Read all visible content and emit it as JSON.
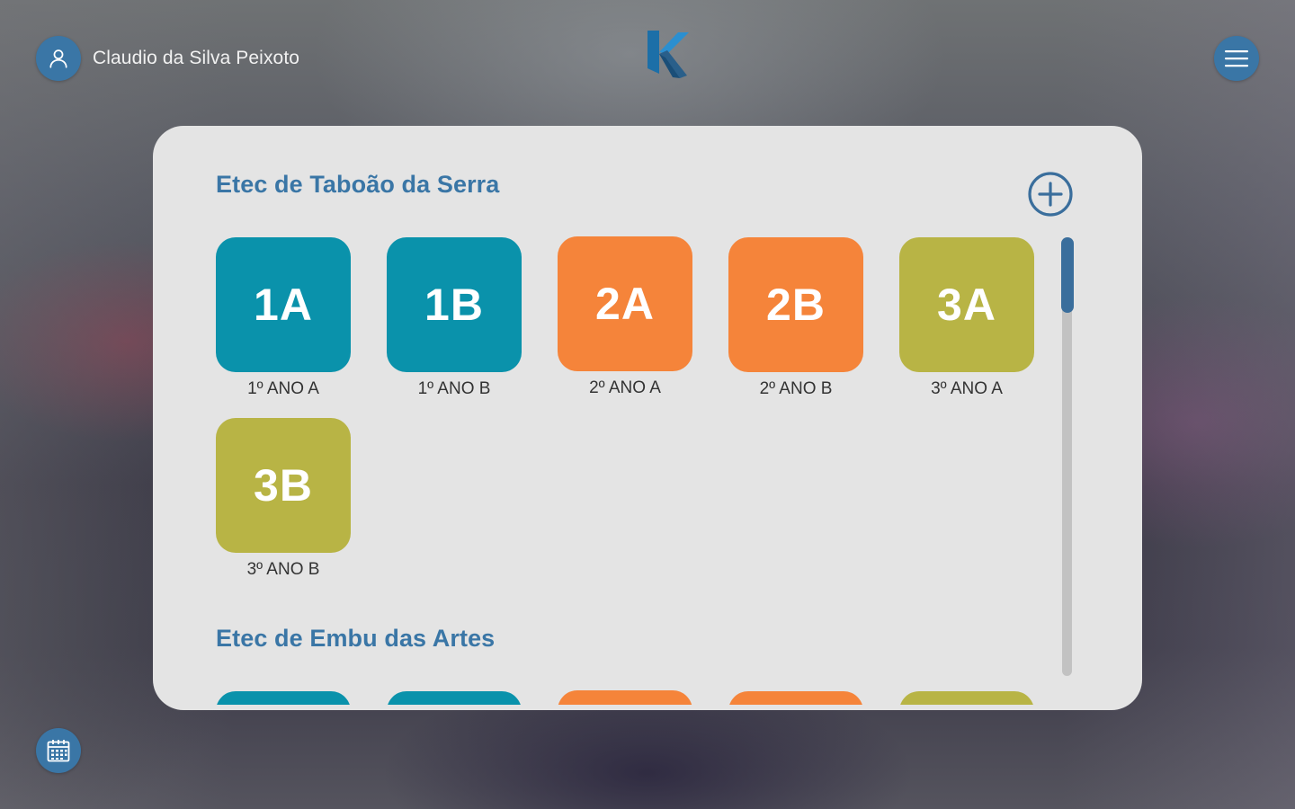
{
  "header": {
    "user_name": "Claudio da Silva Peixoto",
    "user_icon": "user-icon",
    "menu_icon": "hamburger-menu-icon",
    "logo_icon": "k-logo-icon"
  },
  "footer": {
    "calendar_icon": "calendar-icon"
  },
  "panel": {
    "add_icon": "plus-circle-icon",
    "schools": [
      {
        "name": "Etec de Taboão da Serra",
        "classes": [
          {
            "code": "1A",
            "label": "1º ANO A",
            "color": "#0a92ab"
          },
          {
            "code": "1B",
            "label": "1º ANO B",
            "color": "#0a92ab"
          },
          {
            "code": "2A",
            "label": "2º ANO A",
            "color": "#f5843a"
          },
          {
            "code": "2B",
            "label": "2º ANO B",
            "color": "#f5843a"
          },
          {
            "code": "3A",
            "label": "3º ANO A",
            "color": "#b8b445"
          },
          {
            "code": "3B",
            "label": "3º ANO B",
            "color": "#b8b445"
          }
        ]
      },
      {
        "name": "Etec de Embu das Artes",
        "classes": [
          {
            "color": "#0a92ab"
          },
          {
            "color": "#0a92ab"
          },
          {
            "color": "#f5843a"
          },
          {
            "color": "#f5843a"
          },
          {
            "color": "#b8b445"
          }
        ]
      }
    ]
  },
  "colors": {
    "accent": "#3a76a6",
    "panel_bg": "#e4e4e4",
    "teal": "#0a92ab",
    "orange": "#f5843a",
    "olive": "#b8b445"
  }
}
